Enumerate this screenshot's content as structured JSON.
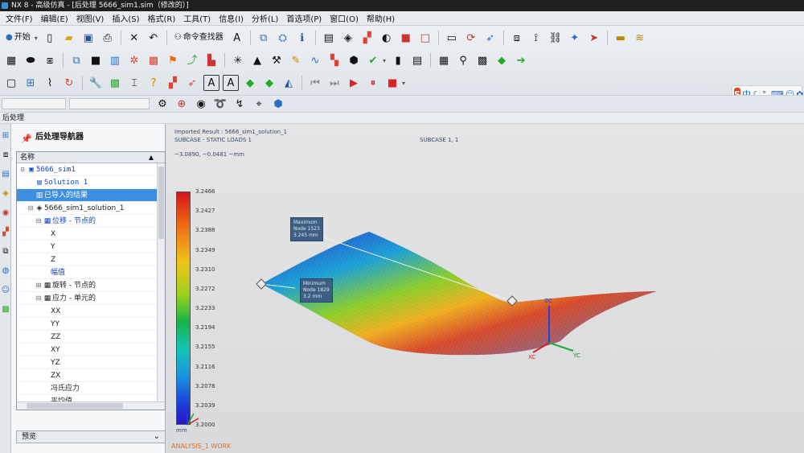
{
  "window": {
    "title": "NX 8 - 高级仿真 - [后处理 5666_sim1.sim（修改的）]"
  },
  "menubar": [
    "文件(F)",
    "编辑(E)",
    "视图(V)",
    "插入(S)",
    "格式(R)",
    "工具(T)",
    "信息(I)",
    "分析(L)",
    "首选项(P)",
    "窗口(O)",
    "帮助(H)"
  ],
  "toolbar": {
    "start_label": "开始",
    "command_finder_label": "命令查找器",
    "rows": [
      [
        "new-icon",
        "open-icon",
        "save-icon",
        "print-icon",
        "close-icon",
        "undo-icon"
      ],
      [
        "display-icon",
        "move-icon",
        "layer-icon",
        "view-icon",
        "snap-icon",
        "render-icon"
      ],
      [
        "grid-icon",
        "clip-icon",
        "mesh-icon",
        "wrench-icon",
        "check-icon",
        "play-icon"
      ]
    ]
  },
  "ime": {
    "logo": "S",
    "label": "中"
  },
  "cue_line": "后处理",
  "navigator": {
    "title": "后处理导航器",
    "column_header": "名称",
    "preview_label": "预览",
    "tree": [
      {
        "level": 0,
        "text": "5666_sim1",
        "expander": "⊟",
        "icon": "▣",
        "style": "blue"
      },
      {
        "level": 1,
        "text": "Solution 1",
        "expander": "",
        "icon": "▤",
        "style": "blue"
      },
      {
        "level": 1,
        "text": "已导入的结果",
        "expander": "",
        "icon": "▥",
        "style": "sel"
      },
      {
        "level": 1,
        "text": "5666_sim1_solution_1",
        "expander": "⊟",
        "icon": "◈",
        "style": "plain"
      },
      {
        "level": 2,
        "text": "位移 - 节点的",
        "expander": "⊟",
        "icon": "▦",
        "style": "bluecn"
      },
      {
        "level": 3,
        "text": "X",
        "expander": "",
        "icon": "",
        "style": "plain"
      },
      {
        "level": 3,
        "text": "Y",
        "expander": "",
        "icon": "",
        "style": "plain"
      },
      {
        "level": 3,
        "text": "Z",
        "expander": "",
        "icon": "",
        "style": "plain"
      },
      {
        "level": 3,
        "text": "幅值",
        "expander": "",
        "icon": "",
        "style": "bluecn"
      },
      {
        "level": 2,
        "text": "旋转 - 节点的",
        "expander": "⊞",
        "icon": "▦",
        "style": "plain"
      },
      {
        "level": 2,
        "text": "应力 - 单元的",
        "expander": "⊟",
        "icon": "▦",
        "style": "plain"
      },
      {
        "level": 3,
        "text": "XX",
        "expander": "",
        "icon": "",
        "style": "plain"
      },
      {
        "level": 3,
        "text": "YY",
        "expander": "",
        "icon": "",
        "style": "plain"
      },
      {
        "level": 3,
        "text": "ZZ",
        "expander": "",
        "icon": "",
        "style": "plain"
      },
      {
        "level": 3,
        "text": "XY",
        "expander": "",
        "icon": "",
        "style": "plain"
      },
      {
        "level": 3,
        "text": "YZ",
        "expander": "",
        "icon": "",
        "style": "plain"
      },
      {
        "level": 3,
        "text": "ZX",
        "expander": "",
        "icon": "",
        "style": "plain"
      },
      {
        "level": 3,
        "text": "冯氏应力",
        "expander": "",
        "icon": "",
        "style": "plain"
      },
      {
        "level": 3,
        "text": "平均值",
        "expander": "",
        "icon": "",
        "style": "plain"
      }
    ]
  },
  "viewport": {
    "header_line1": "Imported Result : 5666_sim1_solution_1",
    "header_line2": "SUBCASE - STATIC LOADS 1",
    "header_center": "SUBCASE 1, 1",
    "header_line3": "~3.0890, ~0.0481 ~mm",
    "legend_values": [
      "3.2466",
      "3.2427",
      "3.2388",
      "3.2349",
      "3.2310",
      "3.2272",
      "3.2233",
      "3.2194",
      "3.2155",
      "3.2116",
      "3.2078",
      "3.2039",
      "3.2000"
    ],
    "legend_unit": "mm",
    "callout_max": [
      "Maximum",
      "Node 1523",
      "3.245 mm"
    ],
    "callout_min": [
      "Minimum",
      "Node 1829",
      "3.2 mm"
    ],
    "axis_labels": {
      "xc": "XC",
      "yc": "YC",
      "zc": "ZC"
    },
    "status": "ANALYSIS_1 WORK"
  },
  "colors": {
    "accent": "#3d8fe0",
    "status": "#e0701a",
    "titlebar": "#1f1f1f"
  }
}
